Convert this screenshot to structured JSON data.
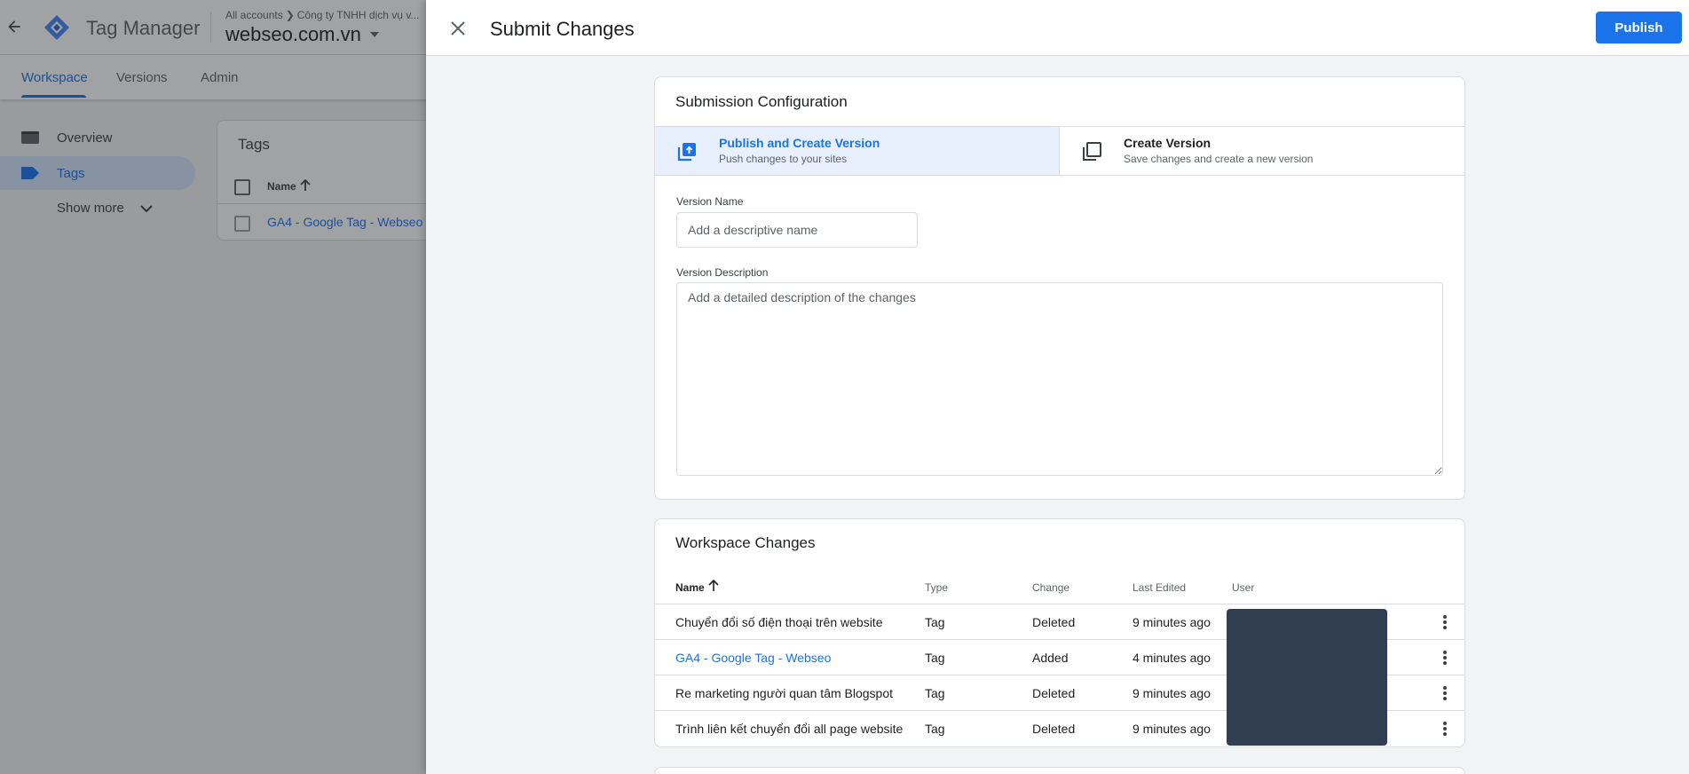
{
  "background_app": {
    "app_name": "Tag Manager",
    "breadcrumb": [
      "All accounts",
      "Công ty TNHH dịch vụ v..."
    ],
    "container_name": "webseo.com.vn",
    "tabs": [
      {
        "label": "Workspace",
        "active": true
      },
      {
        "label": "Versions",
        "active": false
      },
      {
        "label": "Admin",
        "active": false
      }
    ],
    "sidebar": {
      "items": [
        {
          "label": "Overview",
          "icon": "folder-icon",
          "active": false
        },
        {
          "label": "Tags",
          "icon": "tag-icon",
          "active": true
        }
      ],
      "show_more": "Show more"
    },
    "tags_card": {
      "title": "Tags",
      "column_name": "Name",
      "rows": [
        "GA4 - Google Tag - Webseo"
      ]
    },
    "colors": {
      "accent": "#1a73e8",
      "logo": "#4285f4"
    }
  },
  "panel": {
    "title": "Submit Changes",
    "publish_label": "Publish",
    "config": {
      "title": "Submission Configuration",
      "options": [
        {
          "title": "Publish and Create Version",
          "subtitle": "Push changes to your sites",
          "icon": "publish-icon",
          "selected": true
        },
        {
          "title": "Create Version",
          "subtitle": "Save changes and create a new version",
          "icon": "copy-icon",
          "selected": false
        }
      ],
      "version_name_label": "Version Name",
      "version_name_placeholder": "Add a descriptive name",
      "version_name_value": "",
      "version_description_label": "Version Description",
      "version_description_placeholder": "Add a detailed description of the changes",
      "version_description_value": ""
    },
    "changes": {
      "title": "Workspace Changes",
      "columns": [
        "Name",
        "Type",
        "Change",
        "Last Edited",
        "User"
      ],
      "rows": [
        {
          "name": "Chuyển đổi số điện thoại trên website",
          "type": "Tag",
          "change": "Deleted",
          "last_edited": "9 minutes ago",
          "link": false
        },
        {
          "name": "GA4 - Google Tag - Webseo",
          "type": "Tag",
          "change": "Added",
          "last_edited": "4 minutes ago",
          "link": true
        },
        {
          "name": "Re marketing người quan tâm Blogspot",
          "type": "Tag",
          "change": "Deleted",
          "last_edited": "9 minutes ago",
          "link": false
        },
        {
          "name": "Trình liên kết chuyển đổi all page website",
          "type": "Tag",
          "change": "Deleted",
          "last_edited": "9 minutes ago",
          "link": false
        }
      ],
      "user_redaction_color": "#313e51"
    }
  }
}
